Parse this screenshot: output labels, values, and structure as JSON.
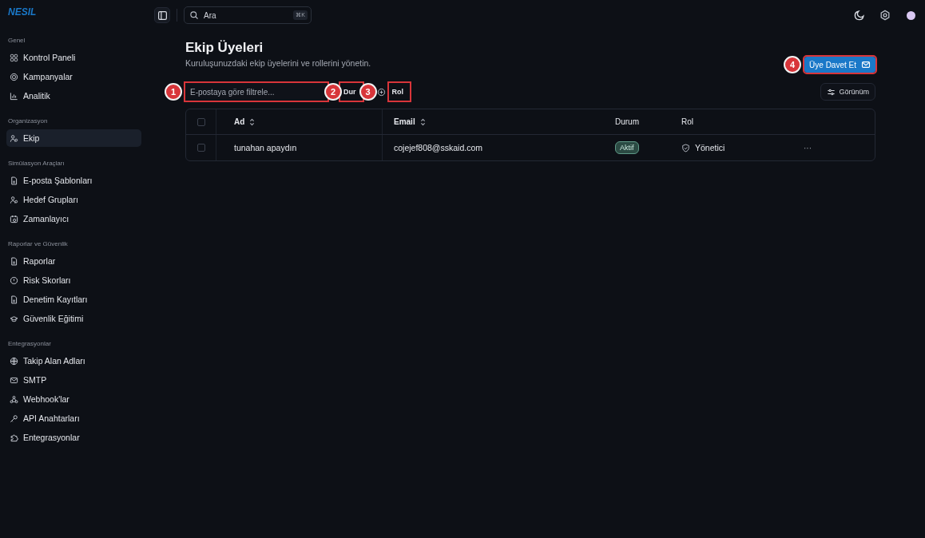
{
  "brand": "NESIL",
  "search": {
    "placeholder": "Ara",
    "shortcut": "⌘K"
  },
  "sidebar": {
    "groups": [
      {
        "title": "Genel",
        "items": [
          {
            "label": "Kontrol Paneli",
            "selected": false
          },
          {
            "label": "Kampanyalar",
            "selected": false
          },
          {
            "label": "Analitik",
            "selected": false
          }
        ]
      },
      {
        "title": "Organizasyon",
        "items": [
          {
            "label": "Ekip",
            "selected": true
          }
        ]
      },
      {
        "title": "Simülasyon Araçları",
        "items": [
          {
            "label": "E-posta Şablonları",
            "selected": false
          },
          {
            "label": "Hedef Grupları",
            "selected": false
          },
          {
            "label": "Zamanlayıcı",
            "selected": false
          }
        ]
      },
      {
        "title": "Raporlar ve Güvenlik",
        "items": [
          {
            "label": "Raporlar",
            "selected": false
          },
          {
            "label": "Risk Skorları",
            "selected": false
          },
          {
            "label": "Denetim Kayıtları",
            "selected": false
          },
          {
            "label": "Güvenlik Eğitimi",
            "selected": false
          }
        ]
      },
      {
        "title": "Entegrasyonlar",
        "items": [
          {
            "label": "Takip Alan Adları",
            "selected": false
          },
          {
            "label": "SMTP",
            "selected": false
          },
          {
            "label": "Webhook'lar",
            "selected": false
          },
          {
            "label": "API Anahtarları",
            "selected": false
          },
          {
            "label": "Entegrasyonlar",
            "selected": false
          }
        ]
      }
    ]
  },
  "page": {
    "title": "Ekip Üyeleri",
    "subtitle": "Kuruluşunuzdaki ekip üyelerini ve rollerini yönetin.",
    "invite_button": {
      "label": "Üye Davet Et",
      "callout": "4"
    }
  },
  "toolbar": {
    "filter": {
      "placeholder": "E-postaya göre filtrele...",
      "callout": "1"
    },
    "status_button": {
      "label": "Dur",
      "callout": "2"
    },
    "role_button": {
      "label": "Rol",
      "callout": "3"
    },
    "view_button": {
      "label": "Görünüm"
    }
  },
  "table": {
    "select_all_checked": false,
    "columns": [
      {
        "label": "Ad",
        "sortable": true
      },
      {
        "label": "Email",
        "sortable": true
      },
      {
        "label": "Durum",
        "sortable": false
      },
      {
        "label": "Rol",
        "sortable": false
      }
    ],
    "rows": [
      {
        "checked": false,
        "name": "tunahan apaydın",
        "email": "cojejef808@sskaid.com",
        "status": "Aktif",
        "role": "Yönetici",
        "more": "···"
      }
    ]
  }
}
